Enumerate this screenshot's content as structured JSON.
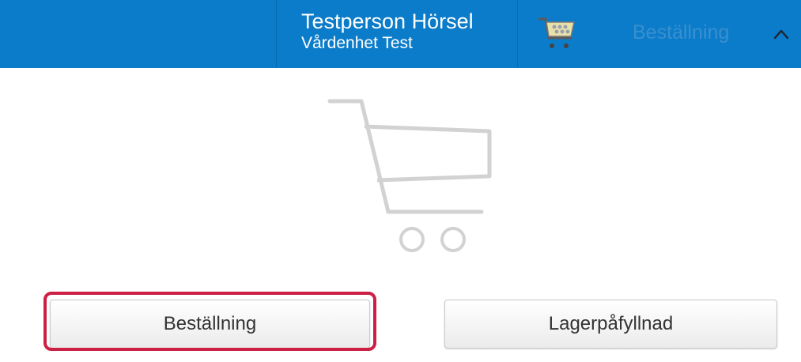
{
  "header": {
    "user_name": "Testperson Hörsel",
    "care_unit": "Vårdenhet Test",
    "cart_icon": "cart-icon",
    "order_label": "Beställning",
    "collapse_icon": "chevron-up-icon",
    "background_color": "#0b7cc9"
  },
  "main": {
    "illustration_icon": "shopping-cart-icon",
    "buttons": {
      "order_label": "Beställning",
      "restock_label": "Lagerpåfyllnad"
    },
    "highlight_color": "#cc1f44"
  }
}
